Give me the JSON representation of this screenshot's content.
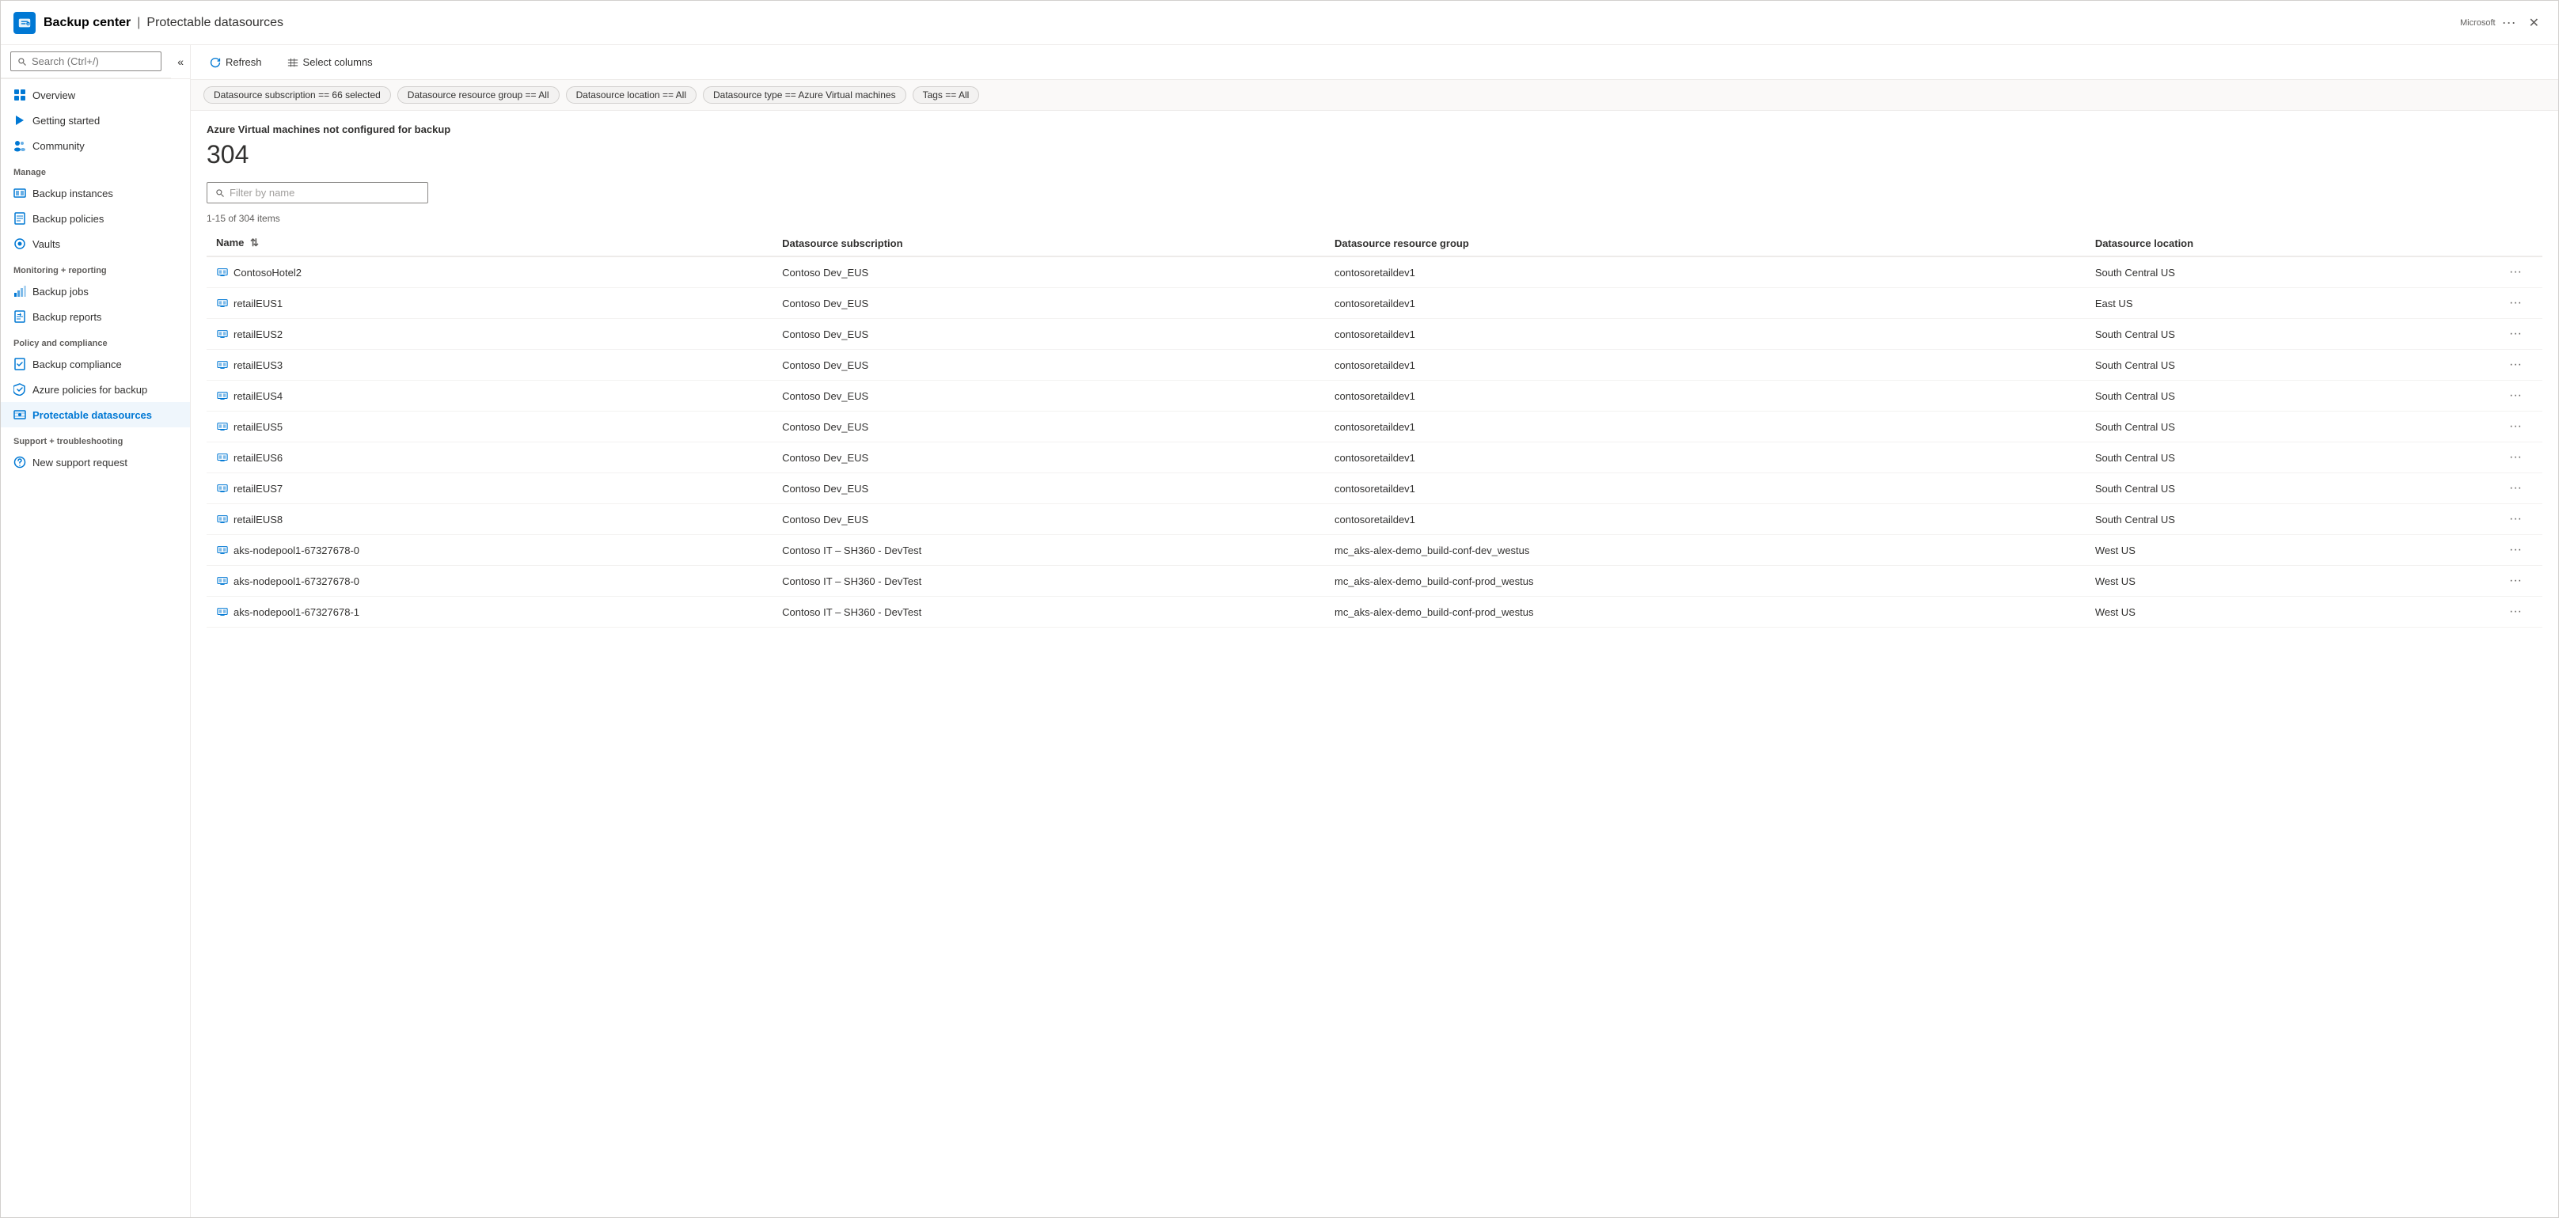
{
  "window": {
    "icon_label": "backup-center-icon",
    "title_main": "Backup center",
    "title_separator": "|",
    "title_sub": "Protectable datasources",
    "subtitle": "Microsoft",
    "ellipsis": "···",
    "close_label": "✕"
  },
  "sidebar": {
    "search_placeholder": "Search (Ctrl+/)",
    "collapse_label": "«",
    "nav_items": [
      {
        "id": "overview",
        "label": "Overview",
        "icon": "overview"
      },
      {
        "id": "getting-started",
        "label": "Getting started",
        "icon": "getting-started"
      },
      {
        "id": "community",
        "label": "Community",
        "icon": "community"
      }
    ],
    "sections": [
      {
        "label": "Manage",
        "items": [
          {
            "id": "backup-instances",
            "label": "Backup instances",
            "icon": "backup-instances"
          },
          {
            "id": "backup-policies",
            "label": "Backup policies",
            "icon": "backup-policies"
          },
          {
            "id": "vaults",
            "label": "Vaults",
            "icon": "vaults"
          }
        ]
      },
      {
        "label": "Monitoring + reporting",
        "items": [
          {
            "id": "backup-jobs",
            "label": "Backup jobs",
            "icon": "backup-jobs"
          },
          {
            "id": "backup-reports",
            "label": "Backup reports",
            "icon": "backup-reports"
          }
        ]
      },
      {
        "label": "Policy and compliance",
        "items": [
          {
            "id": "backup-compliance",
            "label": "Backup compliance",
            "icon": "backup-compliance"
          },
          {
            "id": "azure-policies",
            "label": "Azure policies for backup",
            "icon": "azure-policies"
          },
          {
            "id": "protectable-datasources",
            "label": "Protectable datasources",
            "icon": "protectable-datasources",
            "active": true
          }
        ]
      },
      {
        "label": "Support + troubleshooting",
        "items": [
          {
            "id": "new-support-request",
            "label": "New support request",
            "icon": "support"
          }
        ]
      }
    ]
  },
  "toolbar": {
    "refresh_label": "Refresh",
    "select_columns_label": "Select columns"
  },
  "filters": [
    {
      "id": "subscription",
      "label": "Datasource subscription == 66 selected"
    },
    {
      "id": "resource-group",
      "label": "Datasource resource group == All"
    },
    {
      "id": "location",
      "label": "Datasource location == All"
    },
    {
      "id": "type",
      "label": "Datasource type == Azure Virtual machines"
    },
    {
      "id": "tags",
      "label": "Tags == All"
    }
  ],
  "content": {
    "section_title": "Azure Virtual machines not configured for backup",
    "count": "304",
    "filter_placeholder": "Filter by name",
    "items_range": "1-15 of 304 items",
    "columns": [
      {
        "id": "name",
        "label": "Name",
        "sortable": true
      },
      {
        "id": "subscription",
        "label": "Datasource subscription"
      },
      {
        "id": "resource-group",
        "label": "Datasource resource group"
      },
      {
        "id": "location",
        "label": "Datasource location"
      }
    ],
    "rows": [
      {
        "name": "ContosoHotel2",
        "subscription": "Contoso Dev_EUS",
        "resource_group": "contosoretaildev1",
        "location": "South Central US"
      },
      {
        "name": "retailEUS1",
        "subscription": "Contoso Dev_EUS",
        "resource_group": "contosoretaildev1",
        "location": "East US"
      },
      {
        "name": "retailEUS2",
        "subscription": "Contoso Dev_EUS",
        "resource_group": "contosoretaildev1",
        "location": "South Central US"
      },
      {
        "name": "retailEUS3",
        "subscription": "Contoso Dev_EUS",
        "resource_group": "contosoretaildev1",
        "location": "South Central US"
      },
      {
        "name": "retailEUS4",
        "subscription": "Contoso Dev_EUS",
        "resource_group": "contosoretaildev1",
        "location": "South Central US"
      },
      {
        "name": "retailEUS5",
        "subscription": "Contoso Dev_EUS",
        "resource_group": "contosoretaildev1",
        "location": "South Central US"
      },
      {
        "name": "retailEUS6",
        "subscription": "Contoso Dev_EUS",
        "resource_group": "contosoretaildev1",
        "location": "South Central US"
      },
      {
        "name": "retailEUS7",
        "subscription": "Contoso Dev_EUS",
        "resource_group": "contosoretaildev1",
        "location": "South Central US"
      },
      {
        "name": "retailEUS8",
        "subscription": "Contoso Dev_EUS",
        "resource_group": "contosoretaildev1",
        "location": "South Central US"
      },
      {
        "name": "aks-nodepool1-67327678-0",
        "subscription": "Contoso IT – SH360 - DevTest",
        "resource_group": "mc_aks-alex-demo_build-conf-dev_westus",
        "location": "West US"
      },
      {
        "name": "aks-nodepool1-67327678-0",
        "subscription": "Contoso IT – SH360 - DevTest",
        "resource_group": "mc_aks-alex-demo_build-conf-prod_westus",
        "location": "West US"
      },
      {
        "name": "aks-nodepool1-67327678-1",
        "subscription": "Contoso IT – SH360 - DevTest",
        "resource_group": "mc_aks-alex-demo_build-conf-prod_westus",
        "location": "West US"
      }
    ]
  }
}
